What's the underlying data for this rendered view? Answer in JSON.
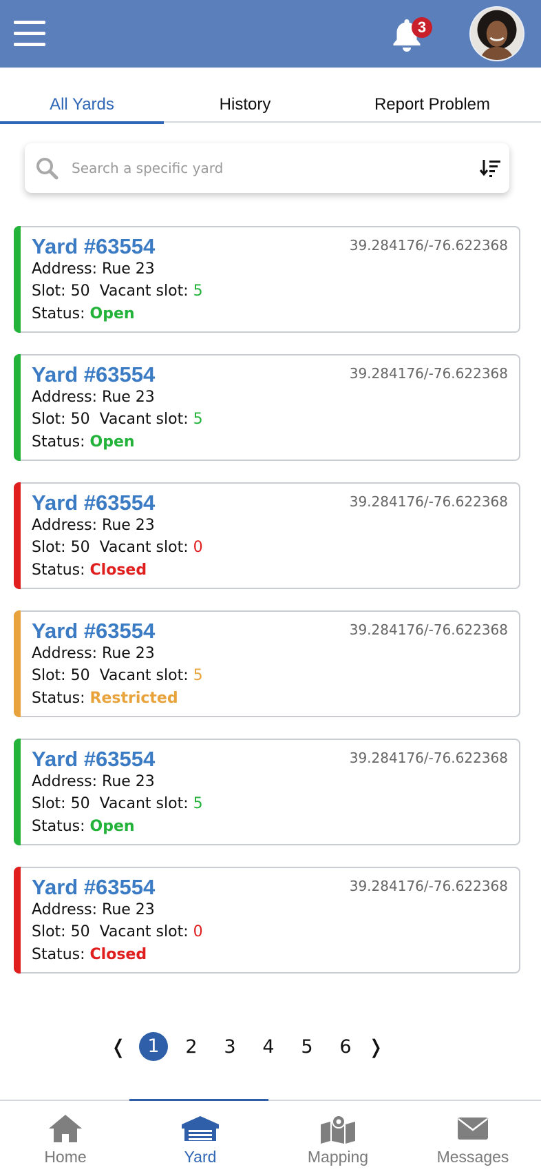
{
  "header": {
    "notification_count": "3"
  },
  "tabs": [
    {
      "label": "All Yards",
      "active": true
    },
    {
      "label": "History",
      "active": false
    },
    {
      "label": "Report Problem",
      "active": false
    }
  ],
  "search": {
    "placeholder": "Search a specific yard",
    "value": ""
  },
  "colors": {
    "open": "#23b33a",
    "closed": "#e01e1e",
    "restricted": "#e8a33d",
    "accent": "#2f66b5"
  },
  "yards": [
    {
      "title": "Yard #63554",
      "coords": "39.284176/-76.622368",
      "address_label": "Address:",
      "address": "Rue 23",
      "slot_label": "Slot:",
      "slot": "50",
      "vacant_label": "Vacant slot:",
      "vacant": "5",
      "status_label": "Status:",
      "status": "Open",
      "state": "open"
    },
    {
      "title": "Yard #63554",
      "coords": "39.284176/-76.622368",
      "address_label": "Address:",
      "address": "Rue 23",
      "slot_label": "Slot:",
      "slot": "50",
      "vacant_label": "Vacant slot:",
      "vacant": "5",
      "status_label": "Status:",
      "status": "Open",
      "state": "open"
    },
    {
      "title": "Yard #63554",
      "coords": "39.284176/-76.622368",
      "address_label": "Address:",
      "address": "Rue 23",
      "slot_label": "Slot:",
      "slot": "50",
      "vacant_label": "Vacant slot:",
      "vacant": "0",
      "status_label": "Status:",
      "status": "Closed",
      "state": "closed"
    },
    {
      "title": "Yard #63554",
      "coords": "39.284176/-76.622368",
      "address_label": "Address:",
      "address": "Rue 23",
      "slot_label": "Slot:",
      "slot": "50",
      "vacant_label": "Vacant slot:",
      "vacant": "5",
      "status_label": "Status:",
      "status": "Restricted",
      "state": "restricted"
    },
    {
      "title": "Yard #63554",
      "coords": "39.284176/-76.622368",
      "address_label": "Address:",
      "address": "Rue 23",
      "slot_label": "Slot:",
      "slot": "50",
      "vacant_label": "Vacant slot:",
      "vacant": "5",
      "status_label": "Status:",
      "status": "Open",
      "state": "open"
    },
    {
      "title": "Yard #63554",
      "coords": "39.284176/-76.622368",
      "address_label": "Address:",
      "address": "Rue 23",
      "slot_label": "Slot:",
      "slot": "50",
      "vacant_label": "Vacant slot:",
      "vacant": "0",
      "status_label": "Status:",
      "status": "Closed",
      "state": "closed"
    }
  ],
  "pagination": {
    "prev": "❬",
    "next": "❭",
    "current_page": 1,
    "pages": [
      "1",
      "2",
      "3",
      "4",
      "5",
      "6"
    ]
  },
  "bottom_nav": [
    {
      "label": "Home",
      "icon": "home-icon",
      "active": false
    },
    {
      "label": "Yard",
      "icon": "yard-garage-icon",
      "active": true
    },
    {
      "label": "Mapping",
      "icon": "map-icon",
      "active": false
    },
    {
      "label": "Messages",
      "icon": "envelope-icon",
      "active": false
    }
  ]
}
